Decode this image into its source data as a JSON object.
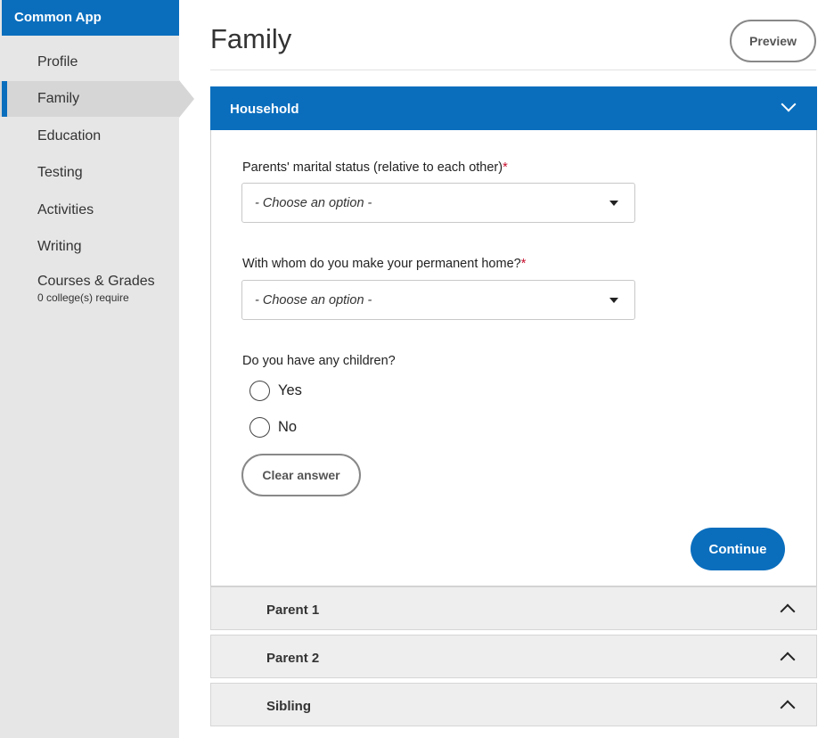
{
  "sidebar": {
    "brand": "Common App",
    "items": [
      {
        "label": "Profile"
      },
      {
        "label": "Family"
      },
      {
        "label": "Education"
      },
      {
        "label": "Testing"
      },
      {
        "label": "Activities"
      },
      {
        "label": "Writing"
      },
      {
        "label": "Courses & Grades",
        "sub": "0 college(s) require"
      }
    ],
    "active_item": "Family"
  },
  "header": {
    "title": "Family",
    "preview_label": "Preview"
  },
  "household": {
    "title": "Household",
    "q1": {
      "label": "Parents' marital status (relative to each other)",
      "required_mark": "*",
      "selected": "- Choose an option -"
    },
    "q2": {
      "label": "With whom do you make your permanent home?",
      "required_mark": "*",
      "selected": "- Choose an option -"
    },
    "q3": {
      "label": "Do you have any children?",
      "options": [
        "Yes",
        "No"
      ]
    },
    "clear_label": "Clear answer",
    "continue_label": "Continue"
  },
  "sections": [
    {
      "label": "Parent 1"
    },
    {
      "label": "Parent 2"
    },
    {
      "label": "Sibling"
    }
  ],
  "colors": {
    "brand_blue": "#0a6ebd",
    "required_red": "#c8102e",
    "sidebar_bg": "#e6e6e6"
  }
}
